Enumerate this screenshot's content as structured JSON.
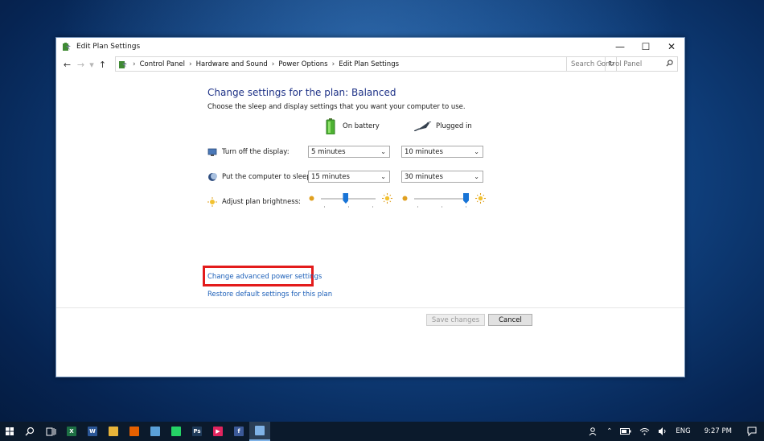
{
  "window": {
    "title": "Edit Plan Settings",
    "controls": {
      "minimize": "—",
      "maximize": "☐",
      "close": "✕"
    }
  },
  "navigation": {
    "back": "←",
    "forward": "→",
    "recent": "▾",
    "up": "↑",
    "breadcrumbs": [
      "Control Panel",
      "Hardware and Sound",
      "Power Options",
      "Edit Plan Settings"
    ],
    "separator": "›",
    "dropdown": "⌄",
    "refresh": "↻",
    "search_placeholder": "Search Control Panel"
  },
  "content": {
    "heading": "Change settings for the plan: Balanced",
    "subheading": "Choose the sleep and display settings that you want your computer to use.",
    "columns": {
      "battery": "On battery",
      "plugged": "Plugged in"
    },
    "rows": {
      "display": {
        "label": "Turn off the display:",
        "battery": "5 minutes",
        "plugged": "10 minutes"
      },
      "sleep": {
        "label": "Put the computer to sleep:",
        "battery": "15 minutes",
        "plugged": "30 minutes"
      },
      "brightness": {
        "label": "Adjust plan brightness:",
        "battery_level": 0.45,
        "plugged_level": 1.0
      }
    },
    "links": {
      "advanced": "Change advanced power settings",
      "restore": "Restore default settings for this plan"
    },
    "buttons": {
      "save": "Save changes",
      "cancel": "Cancel"
    },
    "chevron": "⌄"
  },
  "taskbar": {
    "apps": [
      {
        "name": "excel",
        "glyph": "X",
        "color": "#1d7044"
      },
      {
        "name": "word",
        "glyph": "W",
        "color": "#2b5797"
      },
      {
        "name": "file-explorer",
        "glyph": "",
        "color": "#e8b43a"
      },
      {
        "name": "firefox",
        "glyph": "",
        "color": "#e66000"
      },
      {
        "name": "app",
        "glyph": "",
        "color": "#5aa0d8"
      },
      {
        "name": "whatsapp",
        "glyph": "",
        "color": "#25d366"
      },
      {
        "name": "photoshop",
        "glyph": "Ps",
        "color": "#1f3b5a"
      },
      {
        "name": "media-player",
        "glyph": "▶",
        "color": "#e0245e"
      },
      {
        "name": "facebook",
        "glyph": "f",
        "color": "#3b5998"
      },
      {
        "name": "control-panel",
        "glyph": "",
        "color": "#7fb2e6"
      }
    ],
    "tray": {
      "language": "ENG",
      "time": "9:27 PM"
    }
  }
}
